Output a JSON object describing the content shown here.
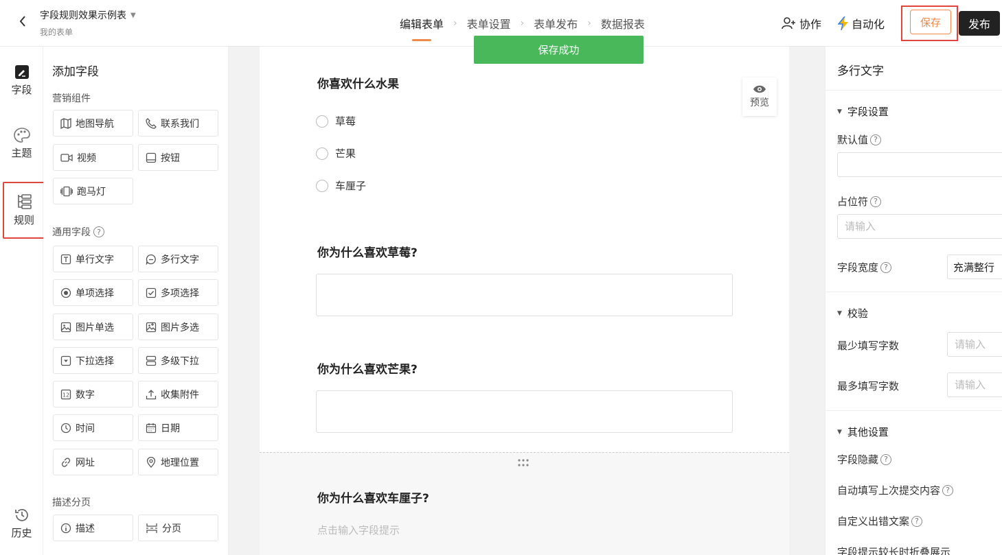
{
  "header": {
    "form_title": "字段规则效果示例表",
    "form_subtitle": "我的表单",
    "steps": [
      "编辑表单",
      "表单设置",
      "表单发布",
      "数据报表"
    ],
    "collab_label": "协作",
    "automation_label": "自动化",
    "save_label": "保存",
    "publish_label": "发布"
  },
  "nav": {
    "items": [
      {
        "label": "字段",
        "icon": "edit-icon"
      },
      {
        "label": "主题",
        "icon": "palette-icon"
      },
      {
        "label": "规则",
        "icon": "tree-icon"
      },
      {
        "label": "历史",
        "icon": "history-icon"
      }
    ]
  },
  "panel": {
    "title": "添加字段",
    "groups": [
      {
        "label": "营销组件",
        "items": [
          {
            "label": "地图导航",
            "icon": "map-icon"
          },
          {
            "label": "联系我们",
            "icon": "phone-icon"
          },
          {
            "label": "视频",
            "icon": "video-icon"
          },
          {
            "label": "按钮",
            "icon": "button-icon"
          },
          {
            "label": "跑马灯",
            "icon": "carousel-icon"
          }
        ]
      },
      {
        "label": "通用字段",
        "items": [
          {
            "label": "单行文字",
            "icon": "text-icon"
          },
          {
            "label": "多行文字",
            "icon": "chat-icon"
          },
          {
            "label": "单项选择",
            "icon": "radio-icon"
          },
          {
            "label": "多项选择",
            "icon": "checkbox-icon"
          },
          {
            "label": "图片单选",
            "icon": "image-icon"
          },
          {
            "label": "图片多选",
            "icon": "image-multi-icon"
          },
          {
            "label": "下拉选择",
            "icon": "dropdown-icon"
          },
          {
            "label": "多级下拉",
            "icon": "cascade-icon"
          },
          {
            "label": "数字",
            "icon": "number-icon"
          },
          {
            "label": "收集附件",
            "icon": "upload-icon"
          },
          {
            "label": "时间",
            "icon": "clock-icon"
          },
          {
            "label": "日期",
            "icon": "calendar-icon"
          },
          {
            "label": "网址",
            "icon": "link-icon"
          },
          {
            "label": "地理位置",
            "icon": "location-icon"
          }
        ]
      },
      {
        "label": "描述分页",
        "items": [
          {
            "label": "描述",
            "icon": "info-icon"
          },
          {
            "label": "分页",
            "icon": "page-break-icon"
          }
        ]
      }
    ]
  },
  "canvas": {
    "toast": "保存成功",
    "preview_label": "预览",
    "q1": {
      "title": "你喜欢什么水果",
      "options": [
        "草莓",
        "芒果",
        "车厘子"
      ]
    },
    "q2": {
      "title": "你为什么喜欢草莓?"
    },
    "q3": {
      "title": "你为什么喜欢芒果?"
    },
    "q4": {
      "title": "你为什么喜欢车厘子?",
      "hint": "点击输入字段提示"
    }
  },
  "props": {
    "title": "多行文字",
    "section_field": "字段设置",
    "default_value_label": "默认值",
    "placeholder_label": "占位符",
    "placeholder_input_placeholder": "请输入",
    "width_label": "字段宽度",
    "width_value": "充满整行",
    "section_validation": "校验",
    "min_chars_label": "最少填写字数",
    "max_chars_label": "最多填写字数",
    "min_placeholder": "请输入",
    "max_placeholder": "请输入",
    "section_other": "其他设置",
    "hide_label": "字段隐藏",
    "autofill_label": "自动填写上次提交内容",
    "custom_error_label": "自定义出错文案",
    "fold_label": "字段提示较长时折叠展示"
  },
  "colors": {
    "accent": "#f08a4b",
    "success": "#49b85b",
    "highlight": "#e0443a",
    "dark": "#222222"
  }
}
